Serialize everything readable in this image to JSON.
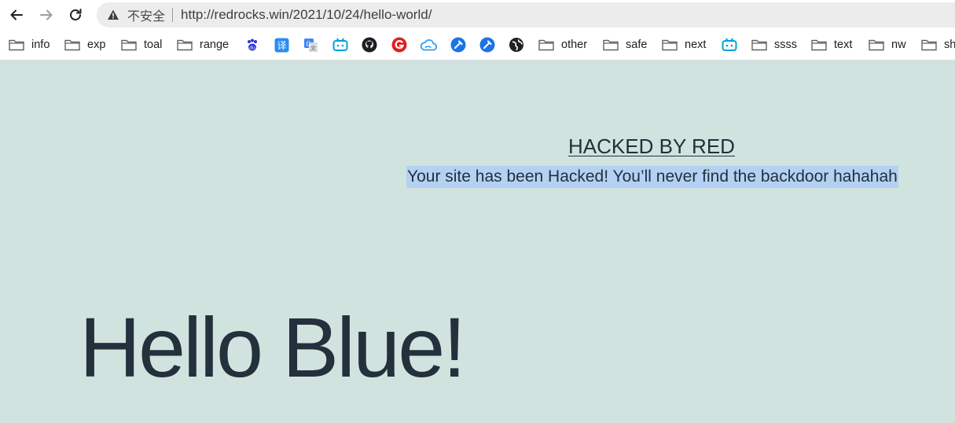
{
  "toolbar": {
    "security_label": "不安全",
    "url": "http://redrocks.win/2021/10/24/hello-world/"
  },
  "bookmarks": [
    {
      "type": "folder",
      "label": "info"
    },
    {
      "type": "folder",
      "label": "exp"
    },
    {
      "type": "folder",
      "label": "toal"
    },
    {
      "type": "folder",
      "label": "range"
    },
    {
      "type": "icon",
      "icon": "baidu-paw-icon"
    },
    {
      "type": "icon",
      "icon": "translate-icon"
    },
    {
      "type": "icon",
      "icon": "google-translate-icon"
    },
    {
      "type": "icon",
      "icon": "bilibili-icon"
    },
    {
      "type": "icon",
      "icon": "github-icon"
    },
    {
      "type": "icon",
      "icon": "red-g-icon"
    },
    {
      "type": "icon",
      "icon": "cloud-icon"
    },
    {
      "type": "icon",
      "icon": "blue-tool-icon"
    },
    {
      "type": "icon",
      "icon": "blue-tool-icon-2"
    },
    {
      "type": "icon",
      "icon": "globe-icon"
    },
    {
      "type": "folder",
      "label": "other"
    },
    {
      "type": "folder",
      "label": "safe"
    },
    {
      "type": "folder",
      "label": "next"
    },
    {
      "type": "icon",
      "icon": "bilibili-icon-2"
    },
    {
      "type": "folder",
      "label": "ssss"
    },
    {
      "type": "folder",
      "label": "text"
    },
    {
      "type": "folder",
      "label": "nw"
    },
    {
      "type": "folder",
      "label": "sh"
    }
  ],
  "page": {
    "hacked_title": "HACKED BY RED",
    "hacked_message": "Your site has been Hacked! You’ll never find the backdoor hahahah",
    "hello": "Hello Blue!"
  },
  "colors": {
    "page_background": "#d1e3de",
    "text": "#24303c",
    "selection": "#b3d1f3"
  }
}
